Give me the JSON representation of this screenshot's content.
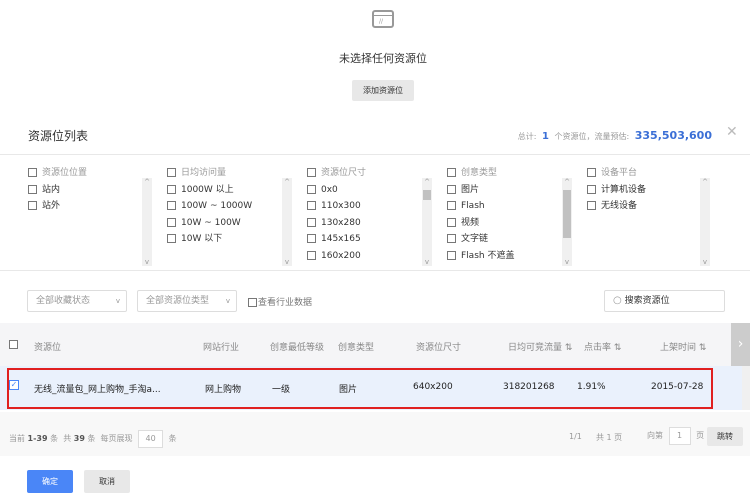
{
  "empty_state": {
    "icon": "empty-placeholder-icon",
    "message": "未选择任何资源位",
    "add_button": "添加资源位"
  },
  "header": {
    "title": "资源位列表",
    "summary_prefix": "总计:",
    "count": "1",
    "summary_mid": "个资源位，流量预估:",
    "traffic": "335,503,600",
    "close_icon": "close-icon"
  },
  "filters": [
    {
      "header": "资源位位置",
      "options": [
        "站内",
        "站外"
      ]
    },
    {
      "header": "日均访问量",
      "options": [
        "1000W 以上",
        "100W ~ 1000W",
        "10W ~ 100W",
        "10W 以下"
      ]
    },
    {
      "header": "资源位尺寸",
      "options": [
        "0x0",
        "110x300",
        "130x280",
        "145x165",
        "160x200"
      ]
    },
    {
      "header": "创意类型",
      "options": [
        "图片",
        "Flash",
        "视频",
        "文字链",
        "Flash 不遮盖"
      ]
    },
    {
      "header": "设备平台",
      "options": [
        "计算机设备",
        "无线设备"
      ]
    }
  ],
  "toolbar": {
    "favorite_select": "全部收藏状态",
    "type_select": "全部资源位类型",
    "industry_checkbox": "查看行业数据",
    "search_placeholder": "搜索资源位"
  },
  "table": {
    "columns": [
      "资源位",
      "网站行业",
      "创意最低等级",
      "创意类型",
      "资源位尺寸",
      "日均可竞流量",
      "点击率",
      "上架时间"
    ],
    "rows": [
      {
        "checked": true,
        "name": "无线_流量包_网上购物_手淘a...",
        "industry": "网上购物",
        "level": "一级",
        "creative": "图片",
        "size": "640x200",
        "traffic": "318201268",
        "ctr": "1.91%",
        "date": "2015-07-28"
      }
    ]
  },
  "pagination": {
    "current_label": "当前",
    "range": "1-39",
    "unit": "条",
    "total_label": "共",
    "total": "39",
    "per_page_label": "每页展现",
    "per_page": "40",
    "page_info": "1/1",
    "total_pages": "共 1 页",
    "goto_label": "向第",
    "goto_value": "1",
    "page_unit": "页",
    "jump": "跳转"
  },
  "footer": {
    "confirm": "确定",
    "cancel": "取消"
  },
  "colors": {
    "primary": "#4a86f7",
    "highlight_border": "#e02020",
    "row_selected": "#eaf1fc"
  }
}
